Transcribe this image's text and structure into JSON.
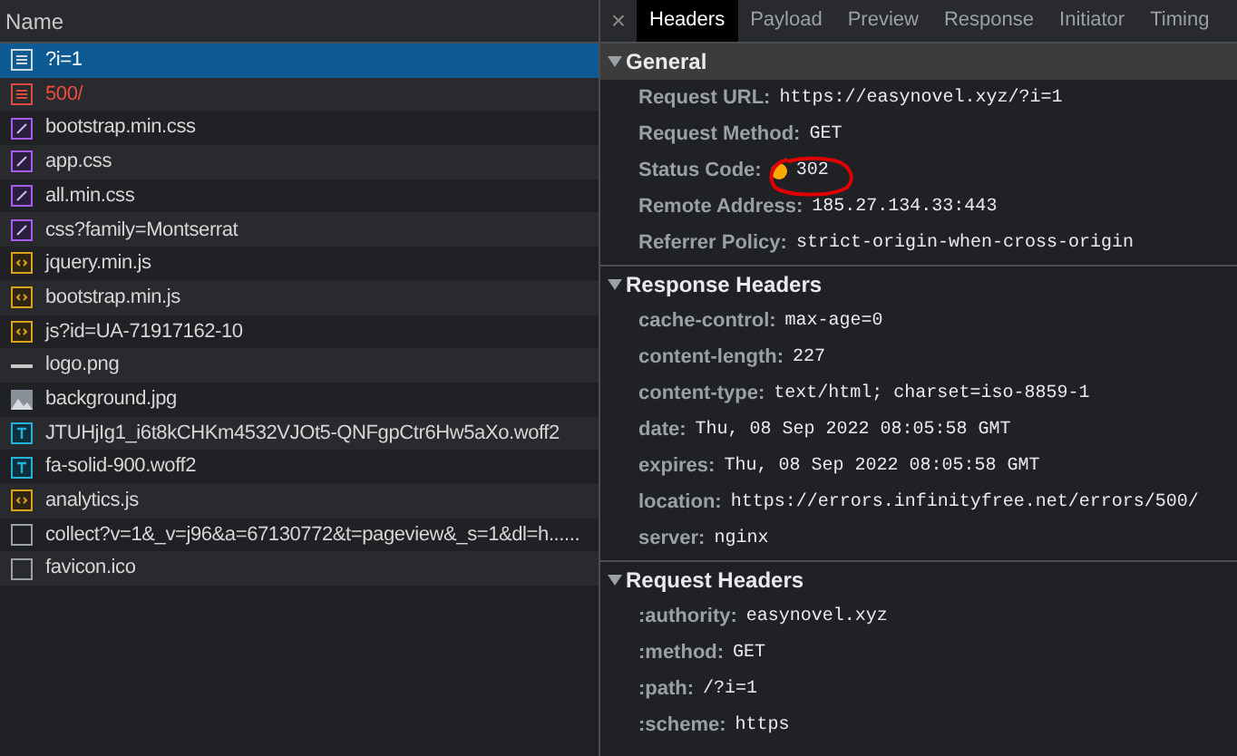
{
  "requests": {
    "column": "Name",
    "rows": [
      {
        "name": "?i=1",
        "kind": "document",
        "selected": true,
        "failed": false
      },
      {
        "name": "500/",
        "kind": "document",
        "selected": false,
        "failed": true
      },
      {
        "name": "bootstrap.min.css",
        "kind": "stylesheet",
        "selected": false,
        "failed": false
      },
      {
        "name": "app.css",
        "kind": "stylesheet",
        "selected": false,
        "failed": false
      },
      {
        "name": "all.min.css",
        "kind": "stylesheet",
        "selected": false,
        "failed": false
      },
      {
        "name": "css?family=Montserrat",
        "kind": "stylesheet",
        "selected": false,
        "failed": false
      },
      {
        "name": "jquery.min.js",
        "kind": "script",
        "selected": false,
        "failed": false
      },
      {
        "name": "bootstrap.min.js",
        "kind": "script",
        "selected": false,
        "failed": false
      },
      {
        "name": "js?id=UA-71917162-10",
        "kind": "script",
        "selected": false,
        "failed": false
      },
      {
        "name": "logo.png",
        "kind": "blank-image",
        "selected": false,
        "failed": false
      },
      {
        "name": "background.jpg",
        "kind": "image",
        "selected": false,
        "failed": false
      },
      {
        "name": "JTUHjIg1_i6t8kCHKm4532VJOt5-QNFgpCtr6Hw5aXo.woff2",
        "kind": "font",
        "selected": false,
        "failed": false
      },
      {
        "name": "fa-solid-900.woff2",
        "kind": "font",
        "selected": false,
        "failed": false
      },
      {
        "name": "analytics.js",
        "kind": "script",
        "selected": false,
        "failed": false
      },
      {
        "name": "collect?v=1&_v=j96&a=67130772&t=pageview&_s=1&dl=h......",
        "kind": "other",
        "selected": false,
        "failed": false
      },
      {
        "name": "favicon.ico",
        "kind": "other",
        "selected": false,
        "failed": false
      }
    ]
  },
  "details": {
    "close": "×",
    "tabs": [
      {
        "label": "Headers",
        "selected": true
      },
      {
        "label": "Payload",
        "selected": false
      },
      {
        "label": "Preview",
        "selected": false
      },
      {
        "label": "Response",
        "selected": false
      },
      {
        "label": "Initiator",
        "selected": false
      },
      {
        "label": "Timing",
        "selected": false
      }
    ],
    "sections": [
      {
        "title": "General",
        "expanded": true,
        "focused": true,
        "rows": [
          {
            "name": "Request URL:",
            "value": "https://easynovel.xyz/?i=1"
          },
          {
            "name": "Request Method:",
            "value": "GET"
          },
          {
            "name": "Status Code:",
            "value": "302",
            "color": "#f9ab00"
          },
          {
            "name": "Remote Address:",
            "value": "185.27.134.33:443"
          },
          {
            "name": "Referrer Policy:",
            "value": "strict-origin-when-cross-origin"
          }
        ]
      },
      {
        "title": "Response Headers",
        "expanded": true,
        "focused": false,
        "rows": [
          {
            "name": "cache-control:",
            "value": "max-age=0"
          },
          {
            "name": "content-length:",
            "value": "227"
          },
          {
            "name": "content-type:",
            "value": "text/html; charset=iso-8859-1"
          },
          {
            "name": "date:",
            "value": "Thu, 08 Sep 2022 08:05:58 GMT"
          },
          {
            "name": "expires:",
            "value": "Thu, 08 Sep 2022 08:05:58 GMT"
          },
          {
            "name": "location:",
            "value": "https://errors.infinityfree.net/errors/500/"
          },
          {
            "name": "server:",
            "value": "nginx"
          }
        ]
      },
      {
        "title": "Request Headers",
        "expanded": true,
        "focused": false,
        "rows": [
          {
            "name": ":authority:",
            "value": "easynovel.xyz"
          },
          {
            "name": ":method:",
            "value": "GET"
          },
          {
            "name": ":path:",
            "value": "/?i=1"
          },
          {
            "name": ":scheme:",
            "value": "https"
          }
        ]
      }
    ]
  }
}
